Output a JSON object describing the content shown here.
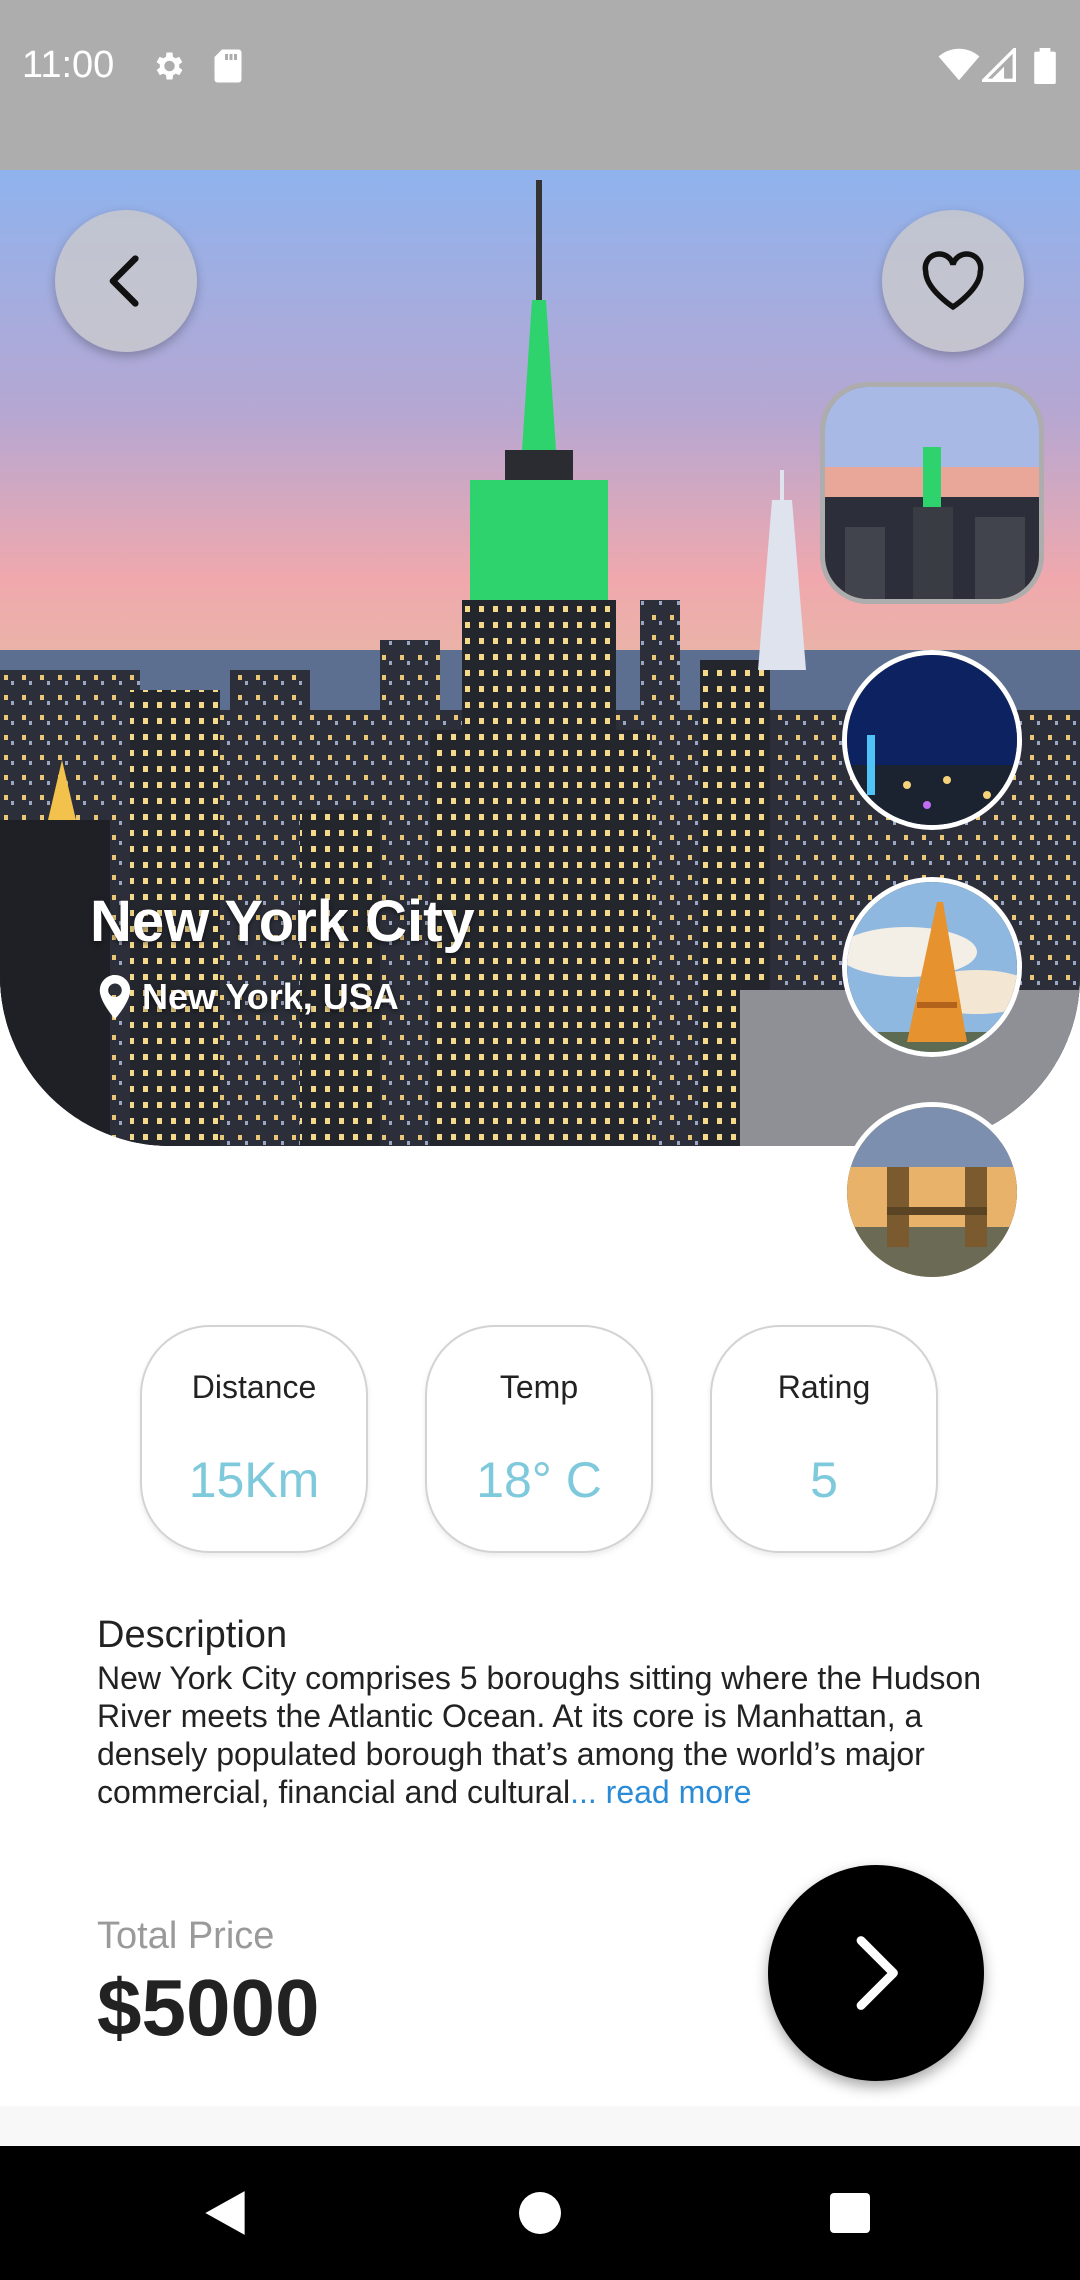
{
  "status_bar": {
    "time": "11:00",
    "icons": [
      "gear-icon",
      "sd-card-icon",
      "wifi-icon",
      "signal-icon",
      "battery-icon"
    ]
  },
  "hero": {
    "title": "New York City",
    "location": "New York, USA",
    "back_icon": "chevron-left-icon",
    "favorite_icon": "heart-outline-icon",
    "thumbnails": [
      "New York City",
      "Night skyline",
      "Eiffel Tower",
      "Tower Bridge"
    ]
  },
  "stats": [
    {
      "label": "Distance",
      "value": "15Km"
    },
    {
      "label": "Temp",
      "value": "18° C"
    },
    {
      "label": "Rating",
      "value": "5"
    }
  ],
  "description": {
    "title": "Description",
    "text": "New York City comprises 5 boroughs sitting where the Hudson River meets the Atlantic Ocean. At its core is Manhattan, a densely populated borough that’s among the world’s major commercial, financial and cultural",
    "read_more": "... read more"
  },
  "price": {
    "label": "Total Price",
    "value": "$5000"
  },
  "colors": {
    "accent": "#7fc9dc",
    "link": "#2a8bd6",
    "button": "#000000"
  },
  "nav": [
    "back-triangle-icon",
    "home-circle-icon",
    "recents-square-icon"
  ]
}
